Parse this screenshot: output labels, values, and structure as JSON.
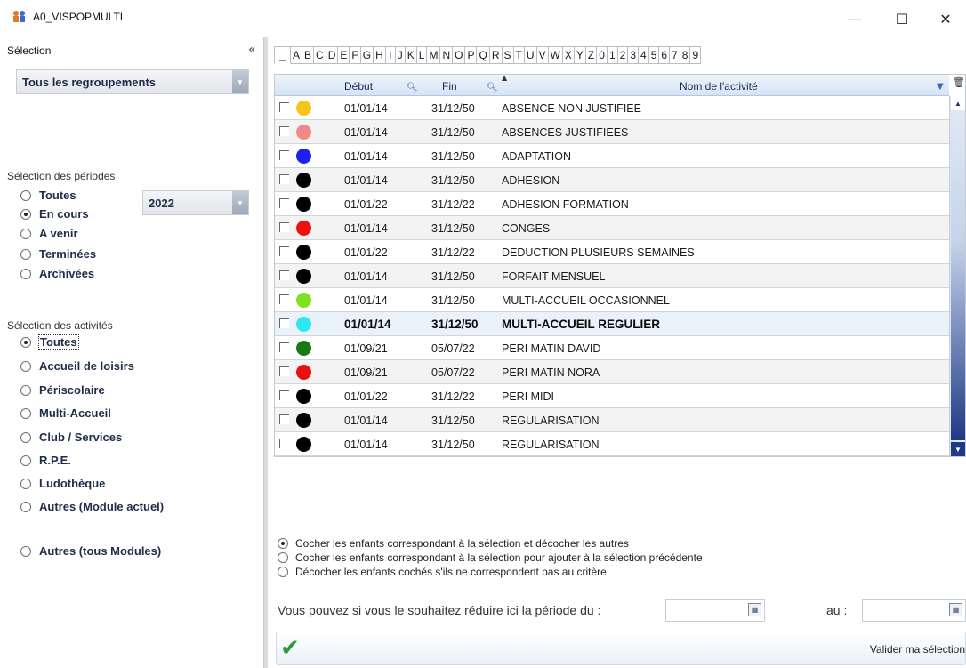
{
  "window": {
    "title": "A0_VISPOPMULTI",
    "minimize": "—",
    "maximize": "☐",
    "close": "✕"
  },
  "left": {
    "header": "Sélection",
    "collapse_icon": "«",
    "regroupement": "Tous les regroupements",
    "periodes_label": "Sélection des périodes",
    "year": "2022",
    "periodes": [
      {
        "label": "Toutes",
        "selected": false
      },
      {
        "label": "En cours",
        "selected": true
      },
      {
        "label": "A venir",
        "selected": false
      },
      {
        "label": "Terminées",
        "selected": false
      },
      {
        "label": "Archivées",
        "selected": false
      }
    ],
    "activites_label": "Sélection des activités",
    "activites": [
      {
        "label": "Toutes",
        "selected": true
      },
      {
        "label": "Accueil de loisirs",
        "selected": false
      },
      {
        "label": "Périscolaire",
        "selected": false
      },
      {
        "label": "Multi-Accueil",
        "selected": false
      },
      {
        "label": "Club / Services",
        "selected": false
      },
      {
        "label": "R.P.E.",
        "selected": false
      },
      {
        "label": "Ludothèque",
        "selected": false
      },
      {
        "label": "Autres (Module actuel)",
        "selected": false
      }
    ],
    "autres_tous": "Autres (tous Modules)"
  },
  "alphabet": [
    "_",
    "A",
    "B",
    "C",
    "D",
    "E",
    "F",
    "G",
    "H",
    "I",
    "J",
    "K",
    "L",
    "M",
    "N",
    "O",
    "P",
    "Q",
    "R",
    "S",
    "T",
    "U",
    "V",
    "W",
    "X",
    "Y",
    "Z",
    "0",
    "1",
    "2",
    "3",
    "4",
    "5",
    "6",
    "7",
    "8",
    "9"
  ],
  "grid": {
    "headers": {
      "debut": "Début",
      "fin": "Fin",
      "nom": "Nom de l'activité"
    },
    "rows": [
      {
        "debut": "01/01/14",
        "fin": "31/12/50",
        "nom": "ABSENCE NON JUSTIFIEE",
        "color": "#f5c518"
      },
      {
        "debut": "01/01/14",
        "fin": "31/12/50",
        "nom": "ABSENCES JUSTIFIEES",
        "color": "#f08a8a"
      },
      {
        "debut": "01/01/14",
        "fin": "31/12/50",
        "nom": "ADAPTATION",
        "color": "#1f1ff0"
      },
      {
        "debut": "01/01/14",
        "fin": "31/12/50",
        "nom": "ADHESION",
        "color": "#000000"
      },
      {
        "debut": "01/01/22",
        "fin": "31/12/22",
        "nom": "ADHESION FORMATION",
        "color": "#000000"
      },
      {
        "debut": "01/01/14",
        "fin": "31/12/50",
        "nom": "CONGES",
        "color": "#f01010"
      },
      {
        "debut": "01/01/22",
        "fin": "31/12/22",
        "nom": "DEDUCTION PLUSIEURS SEMAINES",
        "color": "#000000"
      },
      {
        "debut": "01/01/14",
        "fin": "31/12/50",
        "nom": "FORFAIT MENSUEL",
        "color": "#000000"
      },
      {
        "debut": "01/01/14",
        "fin": "31/12/50",
        "nom": "MULTI-ACCUEIL OCCASIONNEL",
        "color": "#7ee020"
      },
      {
        "debut": "01/01/14",
        "fin": "31/12/50",
        "nom": "MULTI-ACCUEIL REGULIER",
        "color": "#2ee8f0"
      },
      {
        "debut": "01/09/21",
        "fin": "05/07/22",
        "nom": "PERI MATIN DAVID",
        "color": "#157a15"
      },
      {
        "debut": "01/09/21",
        "fin": "05/07/22",
        "nom": "PERI MATIN NORA",
        "color": "#e81010"
      },
      {
        "debut": "01/01/22",
        "fin": "31/12/22",
        "nom": "PERI MIDI",
        "color": "#000000"
      },
      {
        "debut": "01/01/14",
        "fin": "31/12/50",
        "nom": "REGULARISATION",
        "color": "#000000"
      },
      {
        "debut": "01/01/14",
        "fin": "31/12/50",
        "nom": "REGULARISATION",
        "color": "#000000"
      }
    ]
  },
  "options": [
    {
      "label": "Cocher les enfants correspondant à la sélection et décocher les autres",
      "selected": true
    },
    {
      "label": "Cocher les enfants correspondant à la sélection pour ajouter à la sélection précédente",
      "selected": false
    },
    {
      "label": "Décocher les enfants cochés s'ils ne correspondent pas au critère",
      "selected": false
    }
  ],
  "period": {
    "text": "Vous pouvez si vous le souhaitez réduire ici la période du :",
    "au": "au :",
    "du_value": "",
    "au_value": ""
  },
  "validate": {
    "label": "Valider ma sélection"
  }
}
